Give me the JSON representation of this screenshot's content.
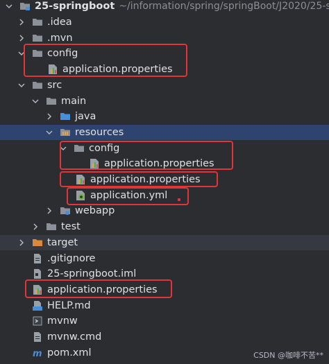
{
  "tree": {
    "root": {
      "label": "25-springboot",
      "path": "~/information/spring/springBoot/J2020/25-s"
    },
    "items": [
      {
        "label": ".idea"
      },
      {
        "label": ".mvn"
      },
      {
        "label": "config"
      },
      {
        "label": "application.properties"
      },
      {
        "label": "src"
      },
      {
        "label": "main"
      },
      {
        "label": "java"
      },
      {
        "label": "resources"
      },
      {
        "label": "config"
      },
      {
        "label": "application.properties"
      },
      {
        "label": "application.properties"
      },
      {
        "label": "application.yml"
      },
      {
        "label": "webapp"
      },
      {
        "label": "test"
      },
      {
        "label": "target"
      },
      {
        "label": ".gitignore"
      },
      {
        "label": "25-springboot.iml"
      },
      {
        "label": "application.properties"
      },
      {
        "label": "HELP.md"
      },
      {
        "label": "mvnw"
      },
      {
        "label": "mvnw.cmd"
      },
      {
        "label": "pom.xml"
      }
    ]
  },
  "watermark": "CSDN @咖啡不苦**",
  "colors": {
    "background": "#2b2d30",
    "selection": "#2e436e",
    "folder": "#8c9099",
    "source_folder": "#4a8fd6",
    "excluded_folder": "#d98a3a",
    "highlight_box": "#e0363a"
  }
}
